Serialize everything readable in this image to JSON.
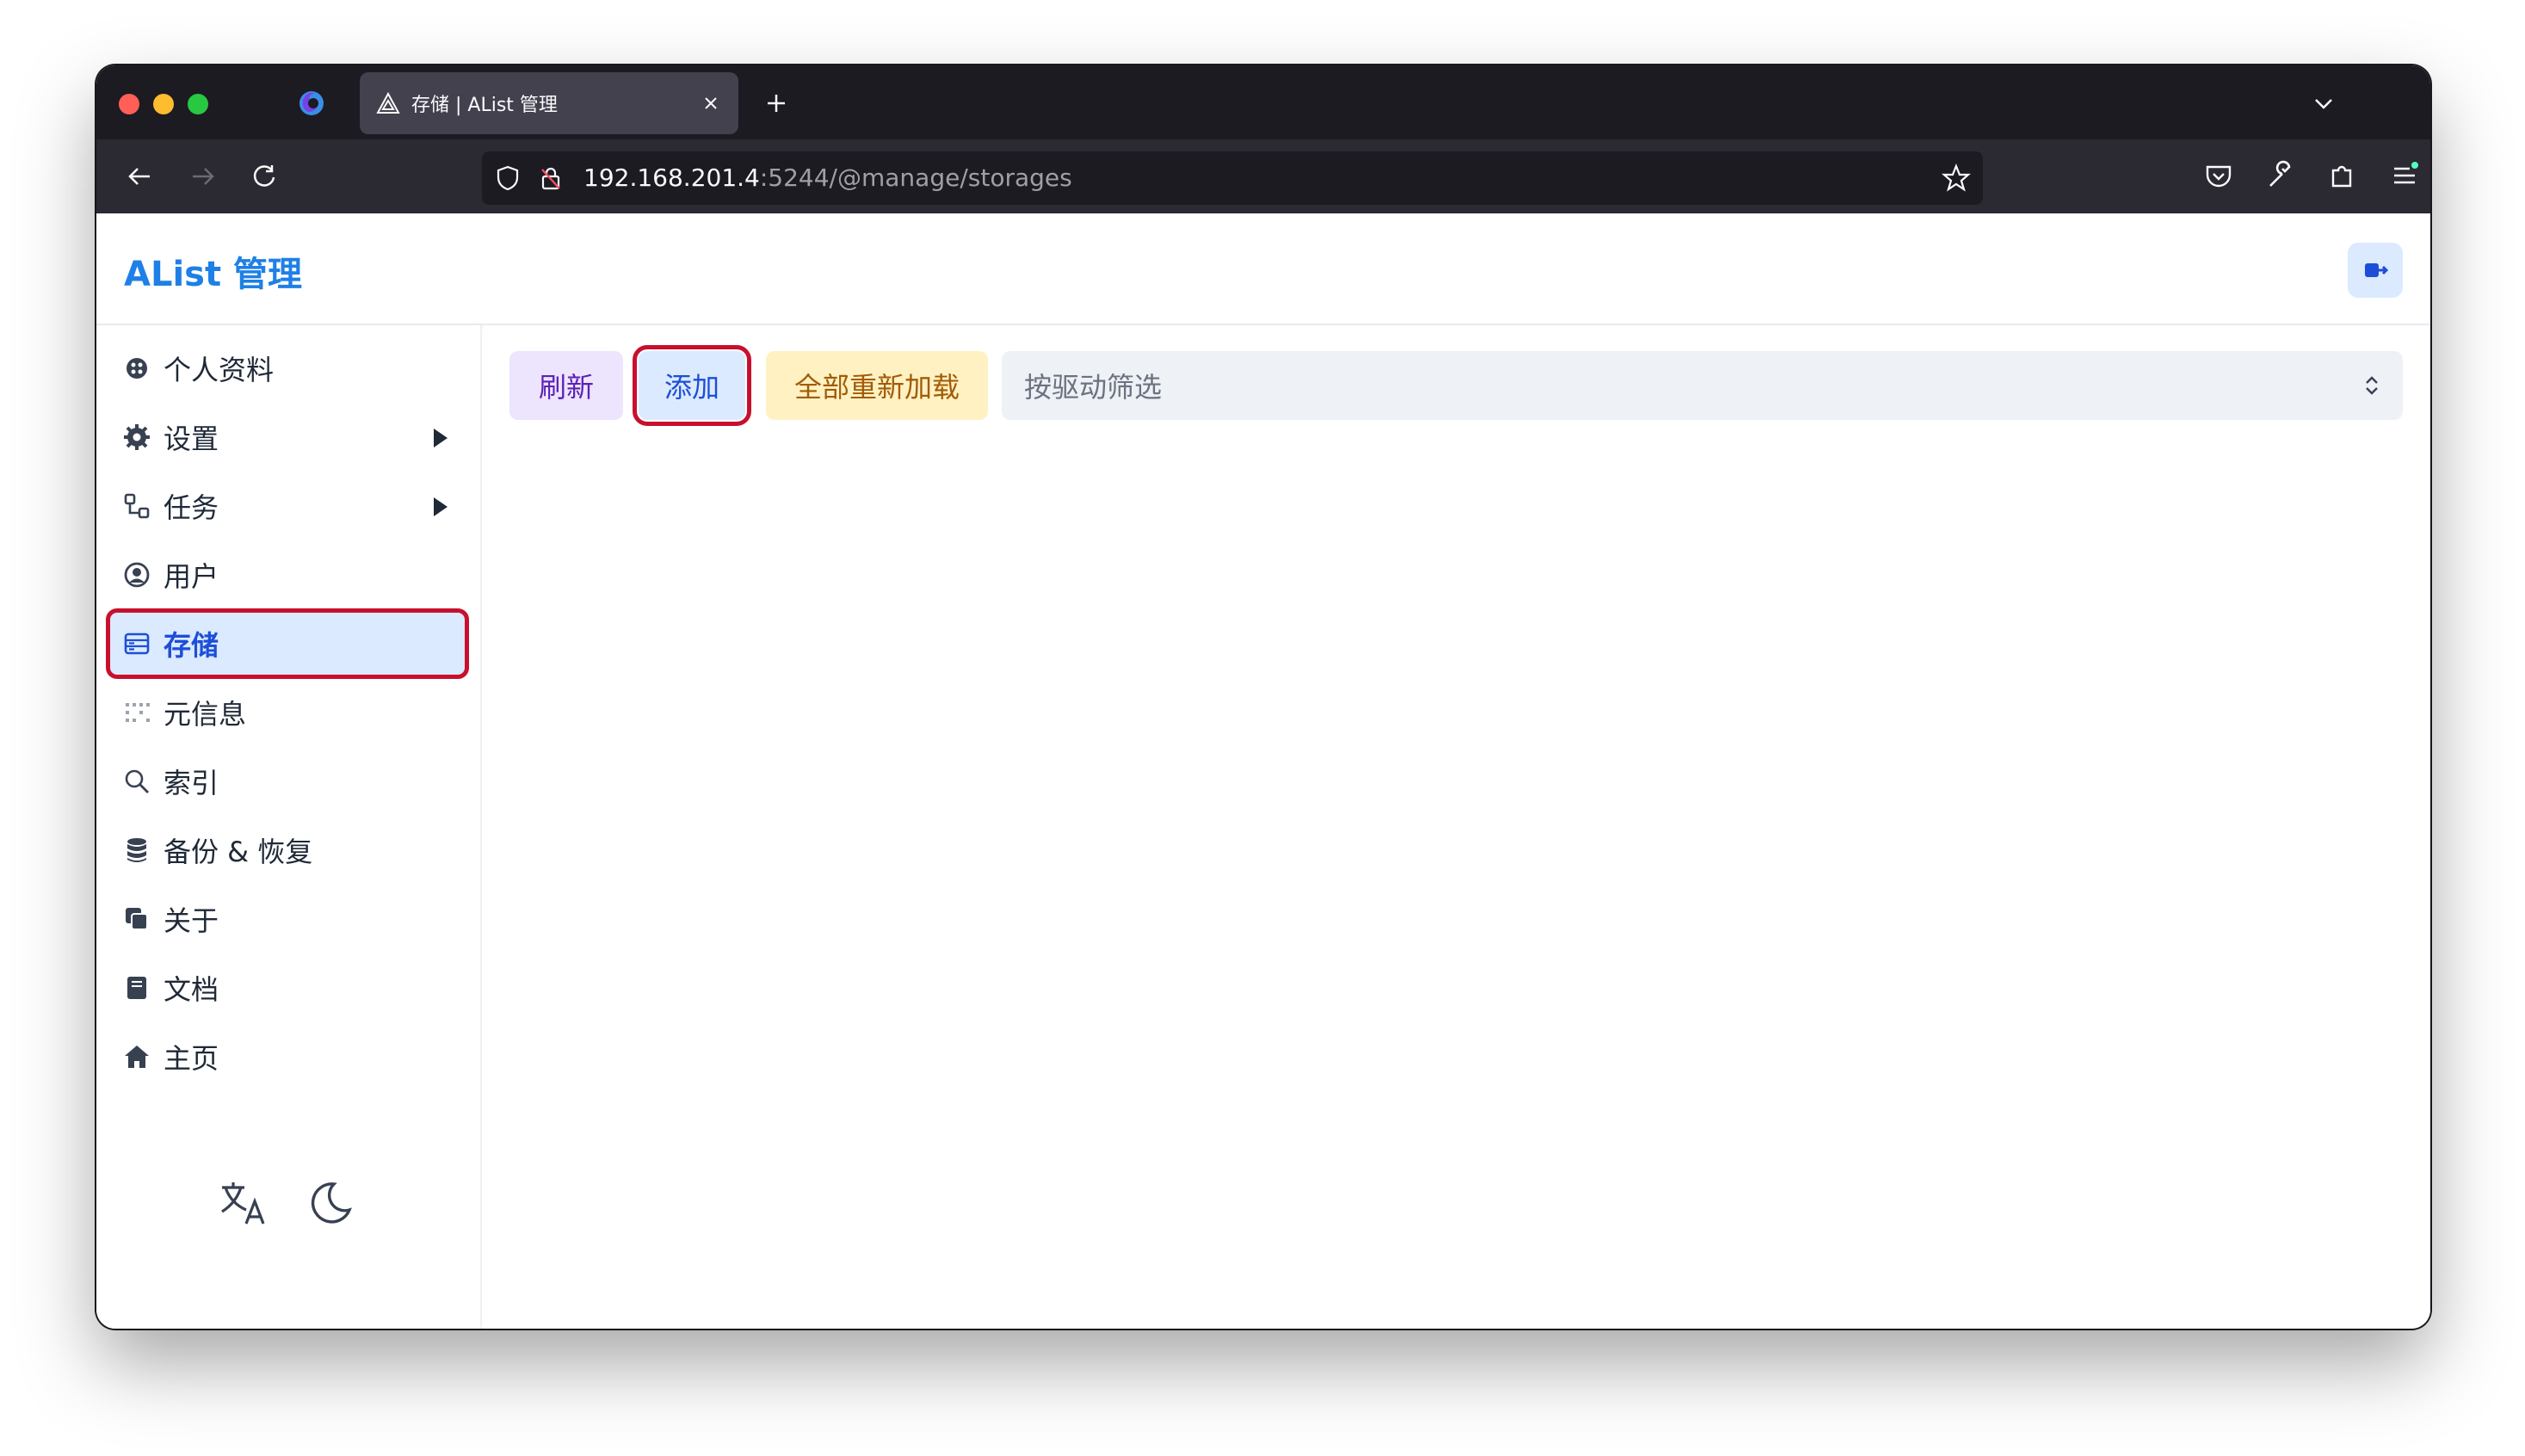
{
  "browser": {
    "tab_title": "存储 | AList 管理",
    "url_host": "192.168.201.4",
    "url_path": ":5244/@manage/storages"
  },
  "header": {
    "title": "AList 管理"
  },
  "sidebar": {
    "items": [
      {
        "label": "个人资料",
        "icon": "profile-icon"
      },
      {
        "label": "设置",
        "icon": "gear-icon"
      },
      {
        "label": "任务",
        "icon": "tasks-icon"
      },
      {
        "label": "用户",
        "icon": "user-circle-icon"
      },
      {
        "label": "存储",
        "icon": "storage-icon"
      },
      {
        "label": "元信息",
        "icon": "meta-icon"
      },
      {
        "label": "索引",
        "icon": "search-icon"
      },
      {
        "label": "备份 & 恢复",
        "icon": "database-icon"
      },
      {
        "label": "关于",
        "icon": "copy-icon"
      },
      {
        "label": "文档",
        "icon": "book-icon"
      },
      {
        "label": "主页",
        "icon": "home-icon"
      }
    ],
    "active": "存储"
  },
  "toolbar": {
    "refresh_label": "刷新",
    "add_label": "添加",
    "reload_all_label": "全部重新加载",
    "filter_placeholder": "按驱动筛选"
  },
  "colors": {
    "brand": "#1e80e6",
    "highlight": "#c8102e"
  }
}
